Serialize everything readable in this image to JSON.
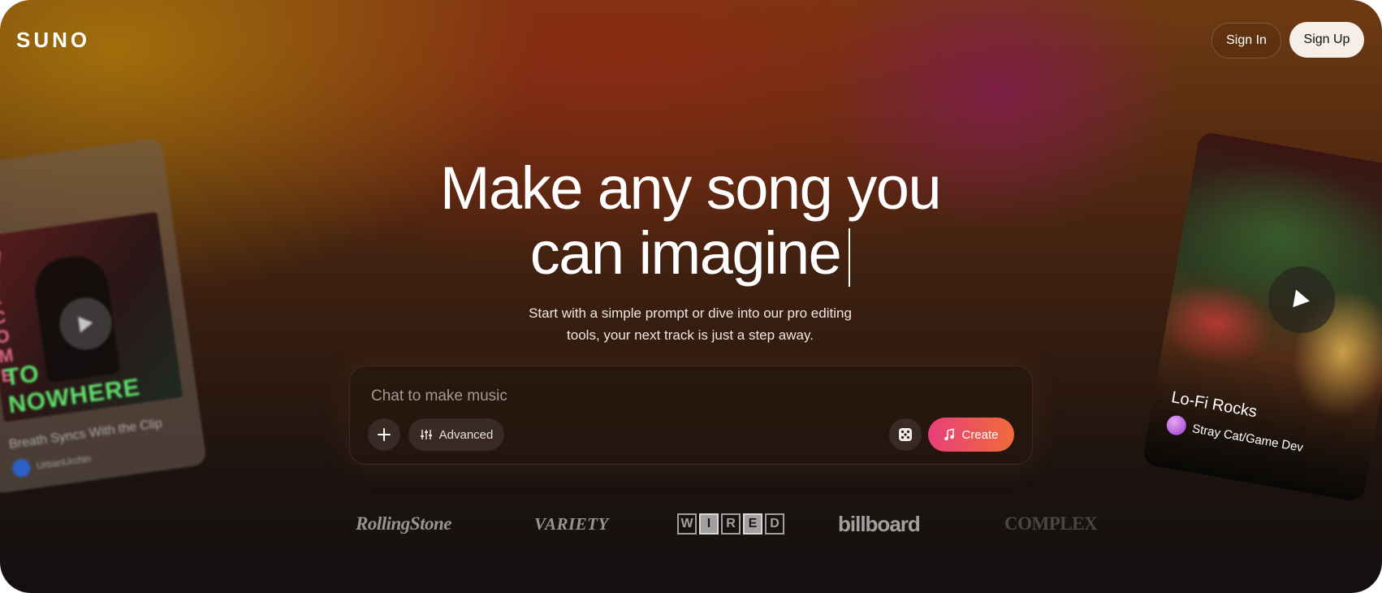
{
  "brand": {
    "logo": "SUNO"
  },
  "nav": {
    "sign_in": "Sign In",
    "sign_up": "Sign Up"
  },
  "hero": {
    "headline_line1": "Make any song you",
    "headline_line2": "can imagine",
    "subtitle_line1": "Start with a simple prompt or dive into our pro editing",
    "subtitle_line2": "tools, your next track is just a step away."
  },
  "composer": {
    "placeholder": "Chat to make music",
    "advanced_label": "Advanced",
    "create_label": "Create",
    "icons": [
      "plus-icon",
      "sliders-icon",
      "dice-icon",
      "music-note-icon"
    ]
  },
  "cards": {
    "left": {
      "title": "Breath Syncs With the Clip",
      "user": "UrbanUrchin",
      "art_text": "TO NOWHERE",
      "art_vertical": "WELCOME"
    },
    "right": {
      "title": "Lo-Fi Rocks",
      "user": "Stray Cat/Game Dev"
    }
  },
  "press": {
    "rolling_stone": "RollingStone",
    "variety": "VARIETY",
    "wired": "WIRED",
    "billboard": "billboard",
    "complex": "COMPLEX"
  },
  "colors": {
    "create_gradient_start": "#e83f7a",
    "create_gradient_end": "#f06b3a",
    "signup_bg": "#f5efe8"
  }
}
